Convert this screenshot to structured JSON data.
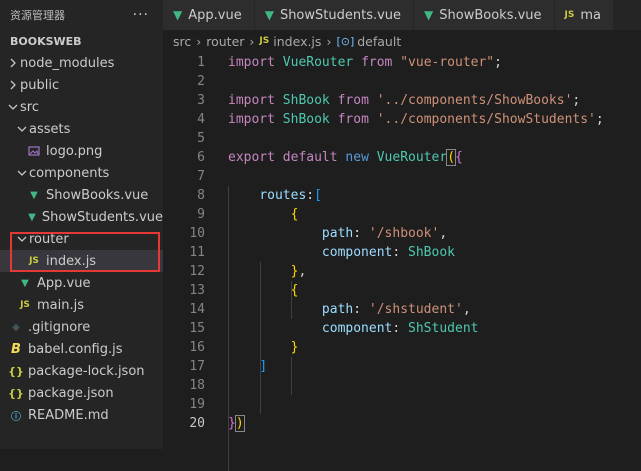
{
  "sidebar": {
    "title": "资源管理器",
    "more": "···",
    "project": "BOOKSWEB",
    "items": [
      {
        "label": "node_modules",
        "kind": "folder-closed",
        "icon": ""
      },
      {
        "label": "public",
        "kind": "folder-closed",
        "icon": ""
      },
      {
        "label": "src",
        "kind": "folder-open",
        "icon": ""
      },
      {
        "label": "assets",
        "kind": "folder-open",
        "icon": ""
      },
      {
        "label": "logo.png",
        "kind": "file",
        "icon": "image-icon"
      },
      {
        "label": "components",
        "kind": "folder-open",
        "icon": ""
      },
      {
        "label": "ShowBooks.vue",
        "kind": "file",
        "icon": "vue-icon"
      },
      {
        "label": "ShowStudents.vue",
        "kind": "file",
        "icon": "vue-icon"
      },
      {
        "label": "router",
        "kind": "folder-open",
        "icon": ""
      },
      {
        "label": "index.js",
        "kind": "file",
        "icon": "js-icon"
      },
      {
        "label": "App.vue",
        "kind": "file",
        "icon": "vue-icon"
      },
      {
        "label": "main.js",
        "kind": "file",
        "icon": "js-icon"
      },
      {
        "label": ".gitignore",
        "kind": "file",
        "icon": "git-icon"
      },
      {
        "label": "babel.config.js",
        "kind": "file",
        "icon": "babel-icon"
      },
      {
        "label": "package-lock.json",
        "kind": "file",
        "icon": "json-icon"
      },
      {
        "label": "package.json",
        "kind": "file",
        "icon": "json-icon"
      },
      {
        "label": "README.md",
        "kind": "file",
        "icon": "info-icon"
      }
    ]
  },
  "tabs": [
    {
      "label": "App.vue",
      "icon": "vue-icon"
    },
    {
      "label": "ShowStudents.vue",
      "icon": "vue-icon"
    },
    {
      "label": "ShowBooks.vue",
      "icon": "vue-icon"
    },
    {
      "label": "ma",
      "icon": "js-icon"
    }
  ],
  "breadcrumb": {
    "folder1": "src",
    "folder2": "router",
    "file": "index.js",
    "symbol": "default",
    "js_badge": "JS"
  },
  "icons": {
    "js_badge": "JS",
    "json_badge": "{}",
    "vue_glyph": "▼",
    "info_glyph": "ⓘ",
    "babel_glyph": "B",
    "git_glyph": "◆"
  },
  "code": {
    "line_numbers": [
      "1",
      "2",
      "3",
      "4",
      "5",
      "6",
      "7",
      "8",
      "9",
      "10",
      "11",
      "12",
      "13",
      "14",
      "15",
      "16",
      "17",
      "18",
      "19",
      "20"
    ],
    "current_line": "20"
  },
  "colors": {
    "accent_vue": "#41b883",
    "accent_js": "#cbcb41",
    "highlight_box": "#e53935"
  }
}
